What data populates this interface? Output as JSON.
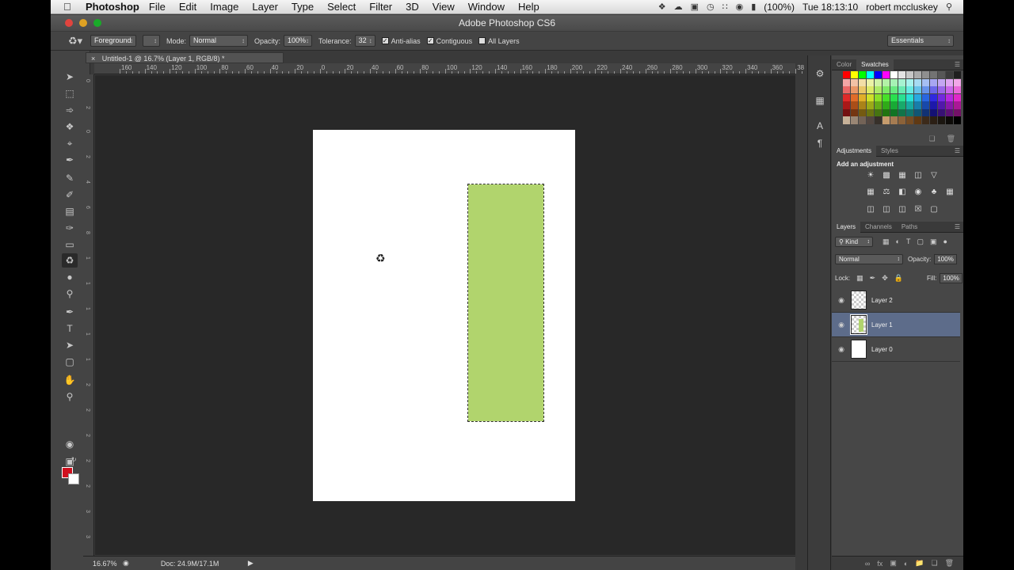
{
  "menubar": {
    "app": "Photoshop",
    "items": [
      "File",
      "Edit",
      "Image",
      "Layer",
      "Type",
      "Select",
      "Filter",
      "3D",
      "View",
      "Window",
      "Help"
    ],
    "battery": "(100%)",
    "clock": "Tue 18:13:10",
    "user": "robert mccluskey"
  },
  "window": {
    "title": "Adobe Photoshop CS6"
  },
  "options": {
    "fill_source": "Foreground",
    "mode_label": "Mode:",
    "mode_value": "Normal",
    "opacity_label": "Opacity:",
    "opacity_value": "100%",
    "tolerance_label": "Tolerance:",
    "tolerance_value": "32",
    "antialias_label": "Anti-alias",
    "contiguous_label": "Contiguous",
    "all_layers_label": "All Layers",
    "workspace": "Essentials"
  },
  "document": {
    "tab_title": "Untitled-1 @ 16.7% (Layer 1, RGB/8) *",
    "ruler_labels": [
      "160",
      "140",
      "120",
      "100",
      "80",
      "60",
      "40",
      "20",
      "0",
      "20",
      "40",
      "60",
      "80",
      "100",
      "120",
      "140",
      "160",
      "180",
      "200",
      "220",
      "240",
      "260",
      "280",
      "300",
      "320",
      "340",
      "360",
      "38"
    ],
    "shape_color": "#b1d46d"
  },
  "status": {
    "zoom": "16.67%",
    "doc_size": "Doc: 24.9M/17.1M"
  },
  "color_panel": {
    "tab_color": "Color",
    "tab_swatches": "Swatches"
  },
  "adjust_panel": {
    "tab_adjustments": "Adjustments",
    "tab_styles": "Styles",
    "heading": "Add an adjustment"
  },
  "layers_panel": {
    "tab_layers": "Layers",
    "tab_channels": "Channels",
    "tab_paths": "Paths",
    "kind": "Kind",
    "blend_mode": "Normal",
    "opacity_label": "Opacity:",
    "opacity_value": "100%",
    "lock_label": "Lock:",
    "fill_label": "Fill:",
    "fill_value": "100%",
    "layers": [
      {
        "name": "Layer 2",
        "selected": false
      },
      {
        "name": "Layer 1",
        "selected": true
      },
      {
        "name": "Layer 0",
        "selected": false
      }
    ]
  },
  "colors": {
    "foreground": "#d0101e",
    "background": "#ffffff",
    "selection_highlight": "#5d6c8a"
  }
}
